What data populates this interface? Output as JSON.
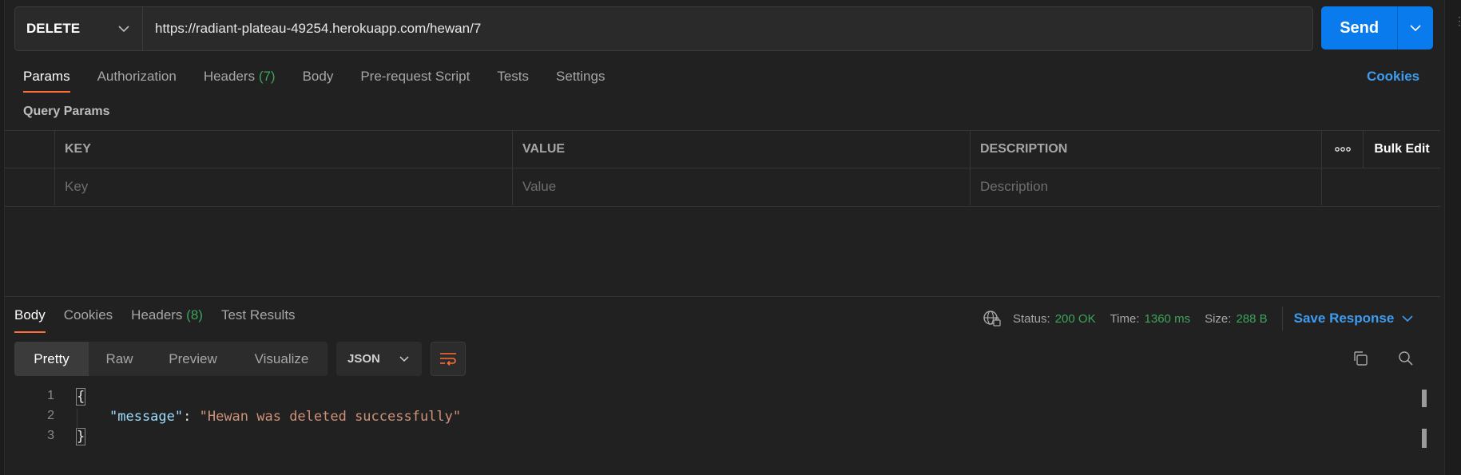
{
  "request": {
    "method": "DELETE",
    "url": "https://radiant-plateau-49254.herokuapp.com/hewan/7",
    "send_label": "Send"
  },
  "request_tabs": [
    {
      "label": "Params",
      "count": ""
    },
    {
      "label": "Authorization",
      "count": ""
    },
    {
      "label": "Headers",
      "count": "(7)"
    },
    {
      "label": "Body",
      "count": ""
    },
    {
      "label": "Pre-request Script",
      "count": ""
    },
    {
      "label": "Tests",
      "count": ""
    },
    {
      "label": "Settings",
      "count": ""
    }
  ],
  "cookies_link": "Cookies",
  "query_params": {
    "title": "Query Params",
    "columns": [
      "KEY",
      "VALUE",
      "DESCRIPTION"
    ],
    "more": "ooo",
    "bulk_edit": "Bulk Edit",
    "placeholders": [
      "Key",
      "Value",
      "Description"
    ]
  },
  "response_tabs": [
    {
      "label": "Body",
      "count": ""
    },
    {
      "label": "Cookies",
      "count": ""
    },
    {
      "label": "Headers",
      "count": "(8)"
    },
    {
      "label": "Test Results",
      "count": ""
    }
  ],
  "response_meta": {
    "status_label": "Status:",
    "status_value": "200 OK",
    "time_label": "Time:",
    "time_value": "1360 ms",
    "size_label": "Size:",
    "size_value": "288 B",
    "save_label": "Save Response"
  },
  "view_options": [
    "Pretty",
    "Raw",
    "Preview",
    "Visualize"
  ],
  "format": "JSON",
  "code_lines": [
    {
      "num": "1",
      "open": "{"
    },
    {
      "num": "2",
      "key": "\"message\"",
      "sep": ": ",
      "value": "\"Hewan was deleted successfully\""
    },
    {
      "num": "3",
      "close": "}"
    }
  ],
  "colors": {
    "accent": "#ff6c37",
    "primary": "#097bed",
    "success": "#3ea35b",
    "link": "#3e9cf0"
  }
}
